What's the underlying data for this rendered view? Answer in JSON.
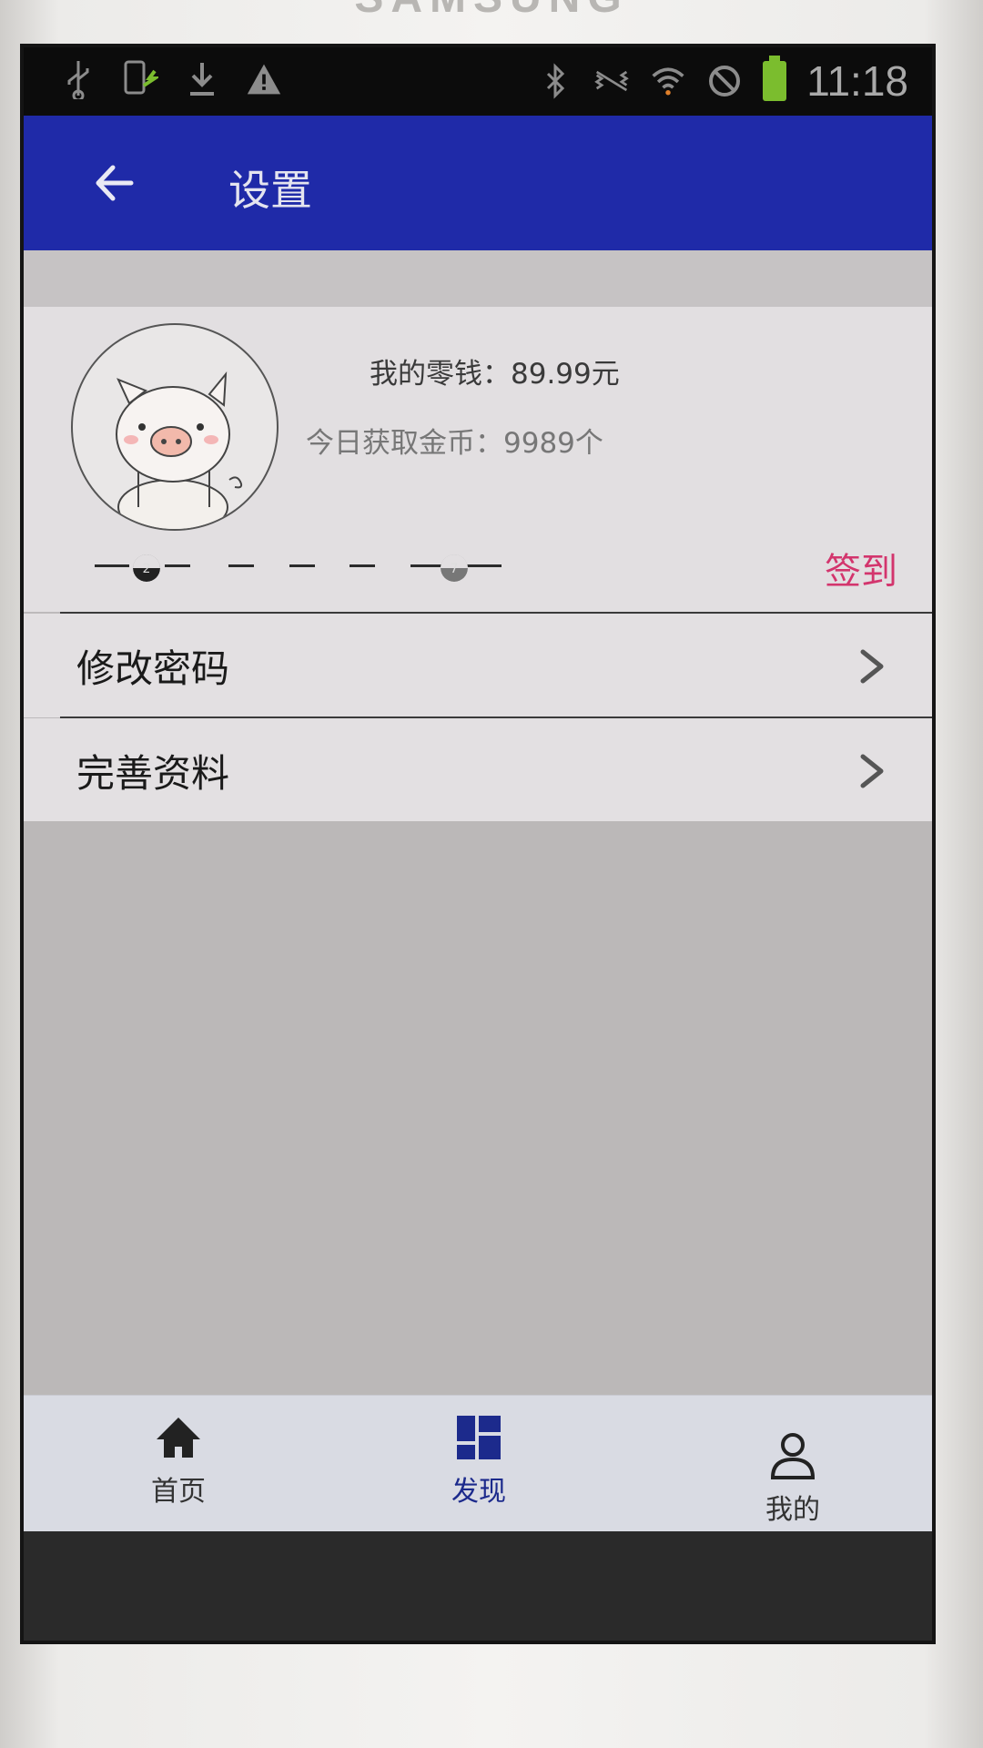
{
  "device": {
    "brand": "SAMSUNG"
  },
  "status_bar": {
    "time": "11:18",
    "left_icons": [
      "usb-icon",
      "phone-sync-icon",
      "download-icon",
      "warning-icon"
    ],
    "right_icons": [
      "bluetooth-icon",
      "vibrate-icon",
      "wifi-icon",
      "blocked-icon",
      "battery-charging-icon"
    ]
  },
  "app_bar": {
    "title": "设置",
    "back_icon": "arrow-left-icon",
    "color": "#1f2aa8"
  },
  "profile": {
    "balance_text": "我的零钱：89.99元",
    "coins_text": "今日获取金币：9989个",
    "checkin_label": "签到",
    "checkin_days": [
      "2",
      "7"
    ],
    "accent": "#d3356d"
  },
  "menu": {
    "items": [
      {
        "label": "修改密码",
        "icon": "chevron-right-icon"
      },
      {
        "label": "完善资料",
        "icon": "chevron-right-icon"
      }
    ]
  },
  "bottom_nav": {
    "items": [
      {
        "label": "首页",
        "icon": "home-icon"
      },
      {
        "label": "发现",
        "icon": "grid-icon",
        "active": true
      },
      {
        "label": "我的",
        "icon": "person-icon"
      }
    ]
  }
}
